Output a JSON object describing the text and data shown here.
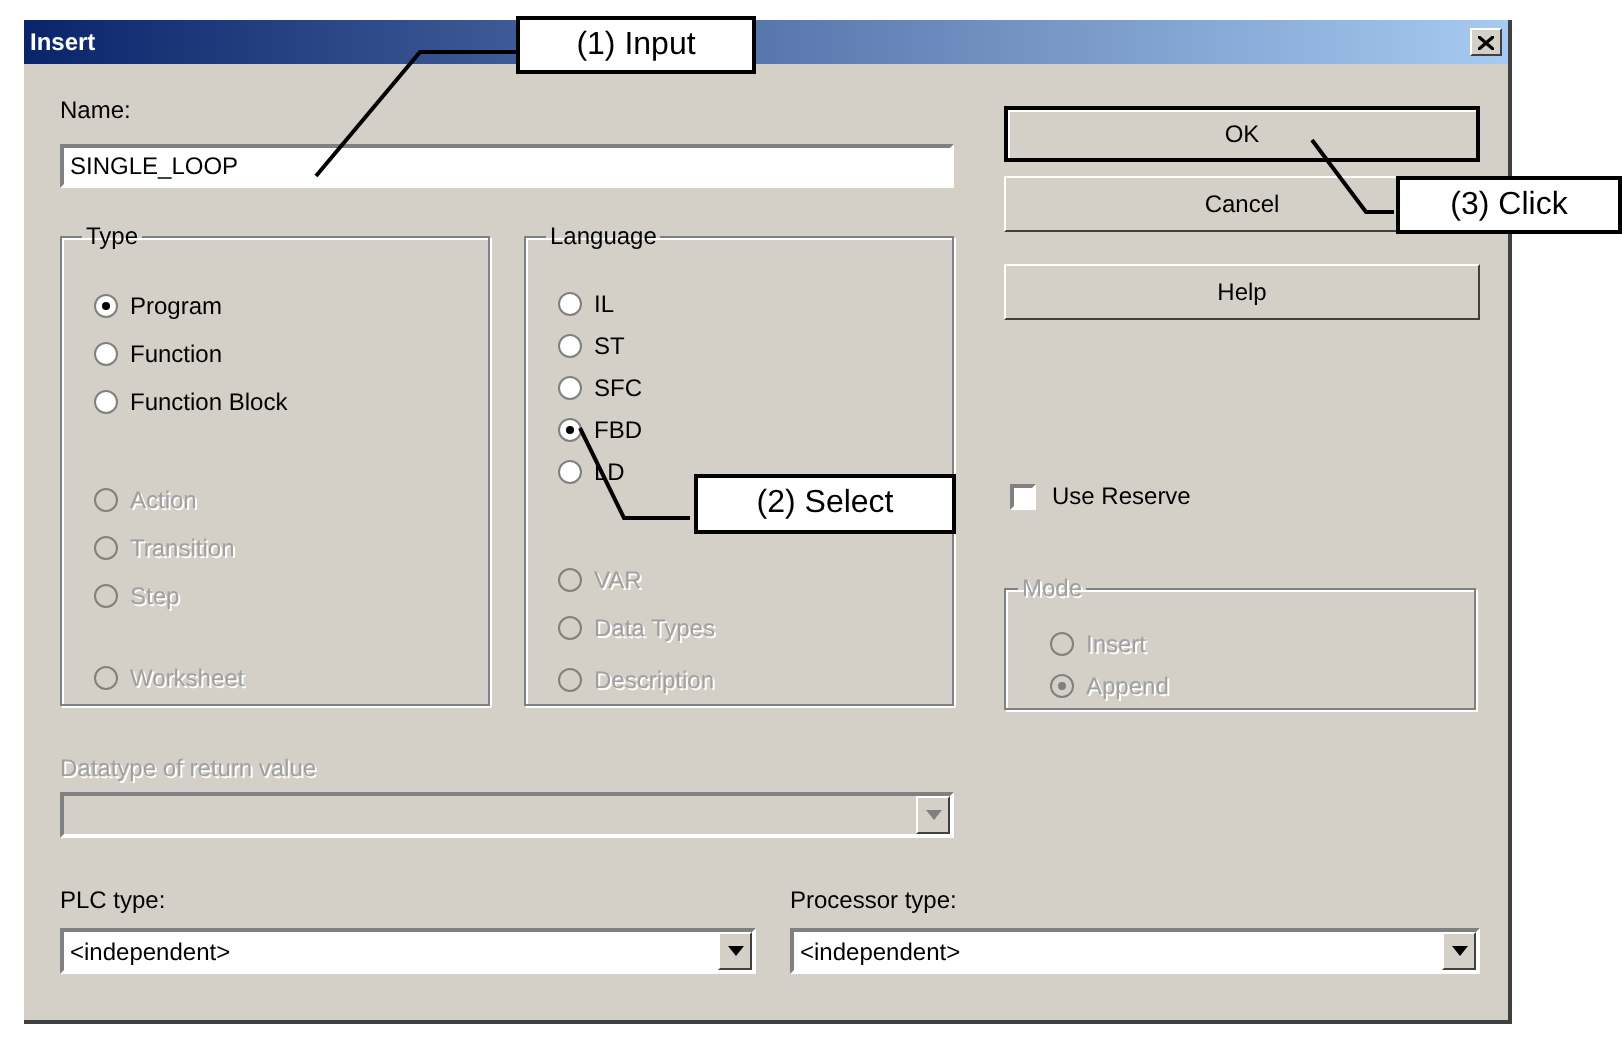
{
  "window": {
    "title": "Insert"
  },
  "name_field": {
    "label": "Name:",
    "value": "SINGLE_LOOP"
  },
  "type_group": {
    "label": "Type",
    "groups": [
      {
        "items": [
          {
            "label": "Program",
            "selected": true,
            "disabled": false
          },
          {
            "label": "Function",
            "selected": false,
            "disabled": false
          },
          {
            "label": "Function Block",
            "selected": false,
            "disabled": false
          }
        ]
      },
      {
        "items": [
          {
            "label": "Action",
            "selected": false,
            "disabled": true
          },
          {
            "label": "Transition",
            "selected": false,
            "disabled": true
          },
          {
            "label": "Step",
            "selected": false,
            "disabled": true
          }
        ]
      },
      {
        "items": [
          {
            "label": "Worksheet",
            "selected": false,
            "disabled": true
          }
        ]
      }
    ]
  },
  "language_group": {
    "label": "Language",
    "groups": [
      {
        "items": [
          {
            "label": "IL",
            "selected": false,
            "disabled": false
          },
          {
            "label": "ST",
            "selected": false,
            "disabled": false
          },
          {
            "label": "SFC",
            "selected": false,
            "disabled": false
          },
          {
            "label": "FBD",
            "selected": true,
            "disabled": false
          },
          {
            "label": "LD",
            "selected": false,
            "disabled": false
          }
        ]
      },
      {
        "items": [
          {
            "label": "VAR",
            "selected": false,
            "disabled": true
          },
          {
            "label": "Data Types",
            "selected": false,
            "disabled": true
          }
        ]
      },
      {
        "items": [
          {
            "label": "Description",
            "selected": false,
            "disabled": true
          }
        ]
      }
    ]
  },
  "buttons": [
    {
      "label": "OK",
      "default": true
    },
    {
      "label": "Cancel",
      "default": false
    },
    {
      "label": "Help",
      "default": false
    }
  ],
  "use_reserve": {
    "label": "Use Reserve",
    "checked": false
  },
  "mode_group": {
    "label": "Mode",
    "items": [
      {
        "label": "Insert",
        "selected": false,
        "disabled": true
      },
      {
        "label": "Append",
        "selected": true,
        "disabled": true
      }
    ]
  },
  "return_type": {
    "label": "Datatype of return value",
    "disabled": true
  },
  "plc_type": {
    "label": "PLC type:",
    "value": "<independent>"
  },
  "processor_type": {
    "label": "Processor type:",
    "value": "<independent>"
  },
  "callouts": [
    {
      "text": "(1) Input"
    },
    {
      "text": "(2) Select"
    },
    {
      "text": "(3) Click"
    }
  ]
}
